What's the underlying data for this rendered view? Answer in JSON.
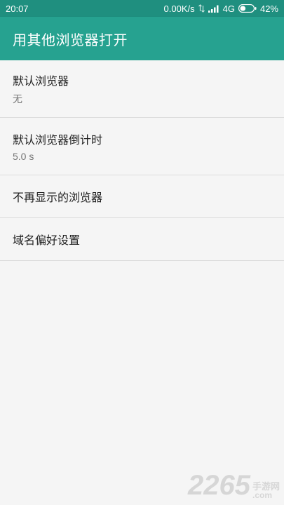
{
  "status_bar": {
    "time": "20:07",
    "network_speed": "0.00K/s",
    "network_type": "4G",
    "battery": "42%",
    "battery_level": 0.42
  },
  "app_bar": {
    "title": "用其他浏览器打开"
  },
  "settings": {
    "default_browser": {
      "title": "默认浏览器",
      "value": "无"
    },
    "countdown": {
      "title": "默认浏览器倒计时",
      "value": "5.0 s"
    },
    "hidden_browsers": {
      "title": "不再显示的浏览器"
    },
    "domain_prefs": {
      "title": "域名偏好设置"
    }
  },
  "watermark": {
    "number": "2265",
    "site_cn": "手游网",
    "site_en": ".com"
  },
  "colors": {
    "status_bar": "#1f8f7f",
    "app_bar": "#26a290",
    "background": "#f5f5f5",
    "divider": "#dcdcdc"
  }
}
